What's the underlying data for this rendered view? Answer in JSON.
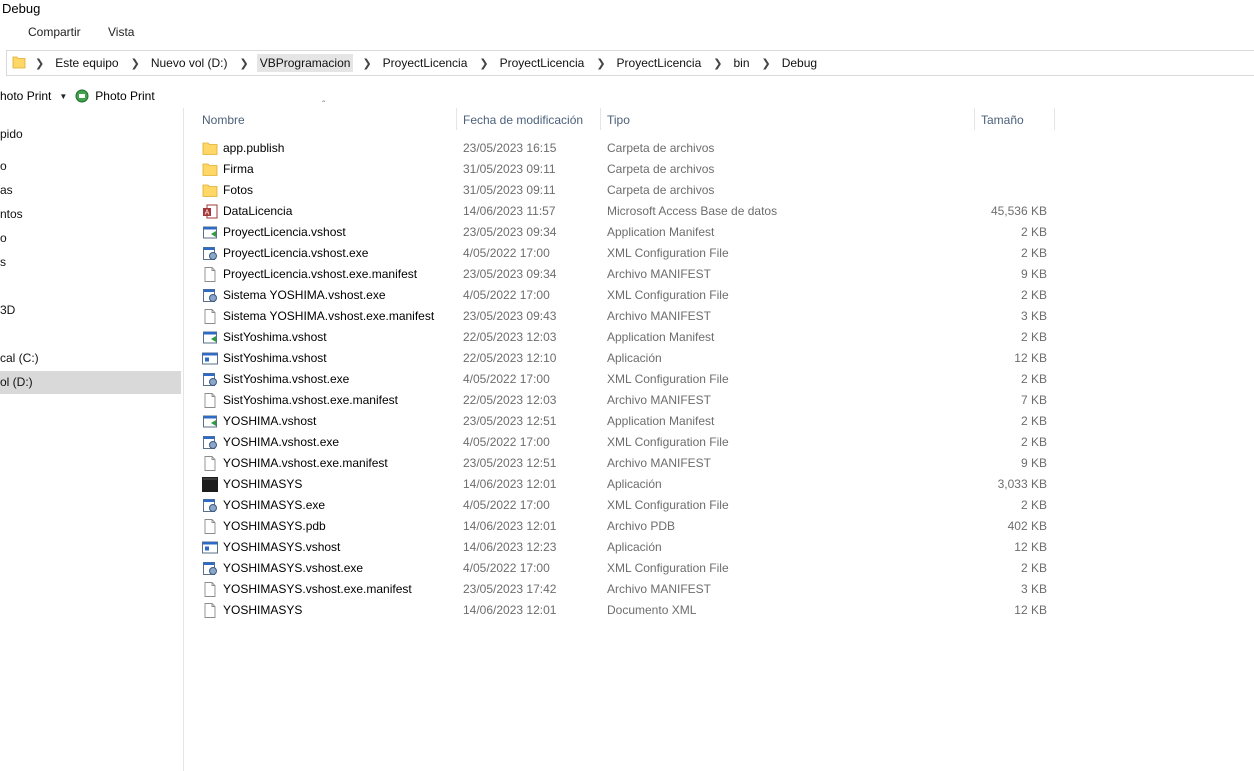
{
  "window": {
    "title": "Debug"
  },
  "ribbon": {
    "tabs": [
      "Compartir",
      "Vista"
    ]
  },
  "address": {
    "crumbs": [
      "Este equipo",
      "Nuevo vol (D:)",
      "VBProgramacion",
      "ProyectLicencia",
      "ProyectLicencia",
      "ProyectLicencia",
      "bin",
      "Debug"
    ],
    "highlighted_index": 2
  },
  "toolbar": {
    "left_label": "hoto Print",
    "button_label": "Photo Print"
  },
  "navpane": {
    "items": [
      "pido",
      "o",
      "as",
      "ntos",
      "o",
      "s",
      "3D",
      "cal (C:)",
      "ol (D:)"
    ],
    "selected_index": 8
  },
  "columns": {
    "name": "Nombre",
    "date": "Fecha de modificación",
    "type": "Tipo",
    "size": "Tamaño"
  },
  "files": [
    {
      "name": "app.publish",
      "date": "23/05/2023 16:15",
      "type": "Carpeta de archivos",
      "size": "",
      "icon": "folder-icon"
    },
    {
      "name": "Firma",
      "date": "31/05/2023 09:11",
      "type": "Carpeta de archivos",
      "size": "",
      "icon": "folder-icon"
    },
    {
      "name": "Fotos",
      "date": "31/05/2023 09:11",
      "type": "Carpeta de archivos",
      "size": "",
      "icon": "folder-icon"
    },
    {
      "name": "DataLicencia",
      "date": "14/06/2023 11:57",
      "type": "Microsoft Access Base de datos",
      "size": "45,536 KB",
      "icon": "access-db-icon"
    },
    {
      "name": "ProyectLicencia.vshost",
      "date": "23/05/2023 09:34",
      "type": "Application Manifest",
      "size": "2 KB",
      "icon": "manifest-icon"
    },
    {
      "name": "ProyectLicencia.vshost.exe",
      "date": "4/05/2022 17:00",
      "type": "XML Configuration File",
      "size": "2 KB",
      "icon": "config-icon"
    },
    {
      "name": "ProyectLicencia.vshost.exe.manifest",
      "date": "23/05/2023 09:34",
      "type": "Archivo MANIFEST",
      "size": "9 KB",
      "icon": "blank-file-icon"
    },
    {
      "name": "Sistema YOSHIMA.vshost.exe",
      "date": "4/05/2022 17:00",
      "type": "XML Configuration File",
      "size": "2 KB",
      "icon": "config-icon"
    },
    {
      "name": "Sistema YOSHIMA.vshost.exe.manifest",
      "date": "23/05/2023 09:43",
      "type": "Archivo MANIFEST",
      "size": "3 KB",
      "icon": "blank-file-icon"
    },
    {
      "name": "SistYoshima.vshost",
      "date": "22/05/2023 12:03",
      "type": "Application Manifest",
      "size": "2 KB",
      "icon": "manifest-icon"
    },
    {
      "name": "SistYoshima.vshost",
      "date": "22/05/2023 12:10",
      "type": "Aplicación",
      "size": "12 KB",
      "icon": "app-icon"
    },
    {
      "name": "SistYoshima.vshost.exe",
      "date": "4/05/2022 17:00",
      "type": "XML Configuration File",
      "size": "2 KB",
      "icon": "config-icon"
    },
    {
      "name": "SistYoshima.vshost.exe.manifest",
      "date": "22/05/2023 12:03",
      "type": "Archivo MANIFEST",
      "size": "7 KB",
      "icon": "blank-file-icon"
    },
    {
      "name": "YOSHIMA.vshost",
      "date": "23/05/2023 12:51",
      "type": "Application Manifest",
      "size": "2 KB",
      "icon": "manifest-icon"
    },
    {
      "name": "YOSHIMA.vshost.exe",
      "date": "4/05/2022 17:00",
      "type": "XML Configuration File",
      "size": "2 KB",
      "icon": "config-icon"
    },
    {
      "name": "YOSHIMA.vshost.exe.manifest",
      "date": "23/05/2023 12:51",
      "type": "Archivo MANIFEST",
      "size": "9 KB",
      "icon": "blank-file-icon"
    },
    {
      "name": "YOSHIMASYS",
      "date": "14/06/2023 12:01",
      "type": "Aplicación",
      "size": "3,033 KB",
      "icon": "dark-app-icon"
    },
    {
      "name": "YOSHIMASYS.exe",
      "date": "4/05/2022 17:00",
      "type": "XML Configuration File",
      "size": "2 KB",
      "icon": "config-icon"
    },
    {
      "name": "YOSHIMASYS.pdb",
      "date": "14/06/2023 12:01",
      "type": "Archivo PDB",
      "size": "402 KB",
      "icon": "blank-file-icon"
    },
    {
      "name": "YOSHIMASYS.vshost",
      "date": "14/06/2023 12:23",
      "type": "Aplicación",
      "size": "12 KB",
      "icon": "app-icon"
    },
    {
      "name": "YOSHIMASYS.vshost.exe",
      "date": "4/05/2022 17:00",
      "type": "XML Configuration File",
      "size": "2 KB",
      "icon": "config-icon"
    },
    {
      "name": "YOSHIMASYS.vshost.exe.manifest",
      "date": "23/05/2023 17:42",
      "type": "Archivo MANIFEST",
      "size": "3 KB",
      "icon": "blank-file-icon"
    },
    {
      "name": "YOSHIMASYS",
      "date": "14/06/2023 12:01",
      "type": "Documento XML",
      "size": "12 KB",
      "icon": "blank-file-icon"
    }
  ],
  "colors": {
    "folder": "#ffd766",
    "header_text": "#4c607a",
    "meta_text": "#6d6d6d",
    "selection": "#d9d9d9"
  }
}
